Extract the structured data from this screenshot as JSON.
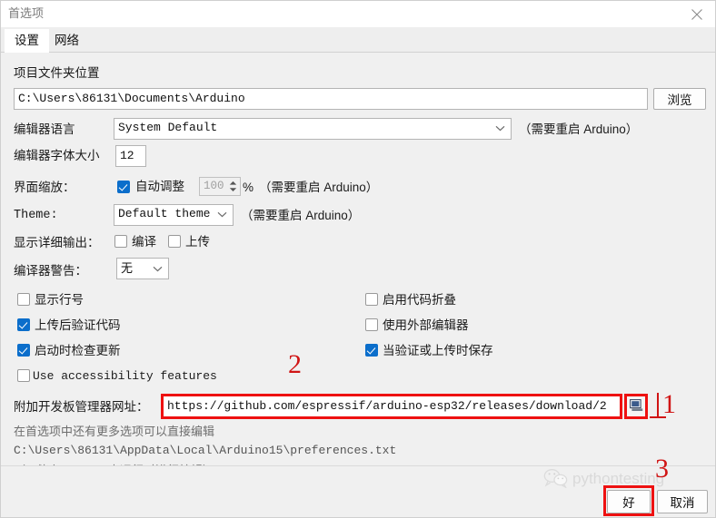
{
  "window": {
    "title": "首选项",
    "close_icon": "close-icon"
  },
  "tabs": [
    {
      "label": "设置",
      "active": true
    },
    {
      "label": "网络",
      "active": false
    }
  ],
  "main": {
    "sketchbook": {
      "label": "项目文件夹位置",
      "value": "C:\\Users\\86131\\Documents\\Arduino",
      "browse_label": "浏览"
    },
    "editor_language": {
      "label": "编辑器语言",
      "value": "System Default",
      "note": "（需要重启 Arduino）"
    },
    "editor_font_size": {
      "label": "编辑器字体大小",
      "value": "12"
    },
    "interface_scale": {
      "label": "界面缩放：",
      "auto_label": "自动调整",
      "auto_checked": true,
      "percent_value": "100",
      "percent_unit": "%",
      "note": "（需要重启 Arduino）"
    },
    "theme": {
      "label": "Theme:",
      "value": "Default theme",
      "note": "（需要重启 Arduino）"
    },
    "verbose_output": {
      "label": "显示详细输出：",
      "compile_label": "编译",
      "compile_checked": false,
      "upload_label": "上传",
      "upload_checked": false
    },
    "compiler_warnings": {
      "label": "编译器警告：",
      "value": "无"
    },
    "checkboxes_left": [
      {
        "label": "显示行号",
        "checked": false
      },
      {
        "label": "上传后验证代码",
        "checked": true
      },
      {
        "label": "启动时检查更新",
        "checked": true
      },
      {
        "label": "Use accessibility features",
        "checked": false,
        "mono": true
      }
    ],
    "checkboxes_right": [
      {
        "label": "启用代码折叠",
        "checked": false
      },
      {
        "label": "使用外部编辑器",
        "checked": false
      },
      {
        "label": "当验证或上传时保存",
        "checked": true
      }
    ],
    "board_manager_urls": {
      "label": "附加开发板管理器网址：",
      "value": "https://github.com/espressif/arduino-esp32/releases/download/2",
      "editor_icon": "window-editor-icon"
    },
    "more_prefs_hint": "在首选项中还有更多选项可以直接编辑",
    "prefs_file_path": "C:\\Users\\86131\\AppData\\Local\\Arduino15\\preferences.txt",
    "prefs_edit_note": "（只能在 Arduino 未运行时进行编辑）"
  },
  "footer": {
    "ok_label": "好",
    "cancel_label": "取消"
  },
  "annotations": [
    {
      "id": "1",
      "number": "1"
    },
    {
      "id": "2",
      "number": "2"
    },
    {
      "id": "3",
      "number": "3"
    }
  ],
  "watermark": {
    "text": "pythontesting",
    "icon": "wechat-icon"
  },
  "colors": {
    "accent": "#0b6ecb",
    "annotation_red": "#ee1111",
    "window_bg": "#f0f0f0"
  }
}
